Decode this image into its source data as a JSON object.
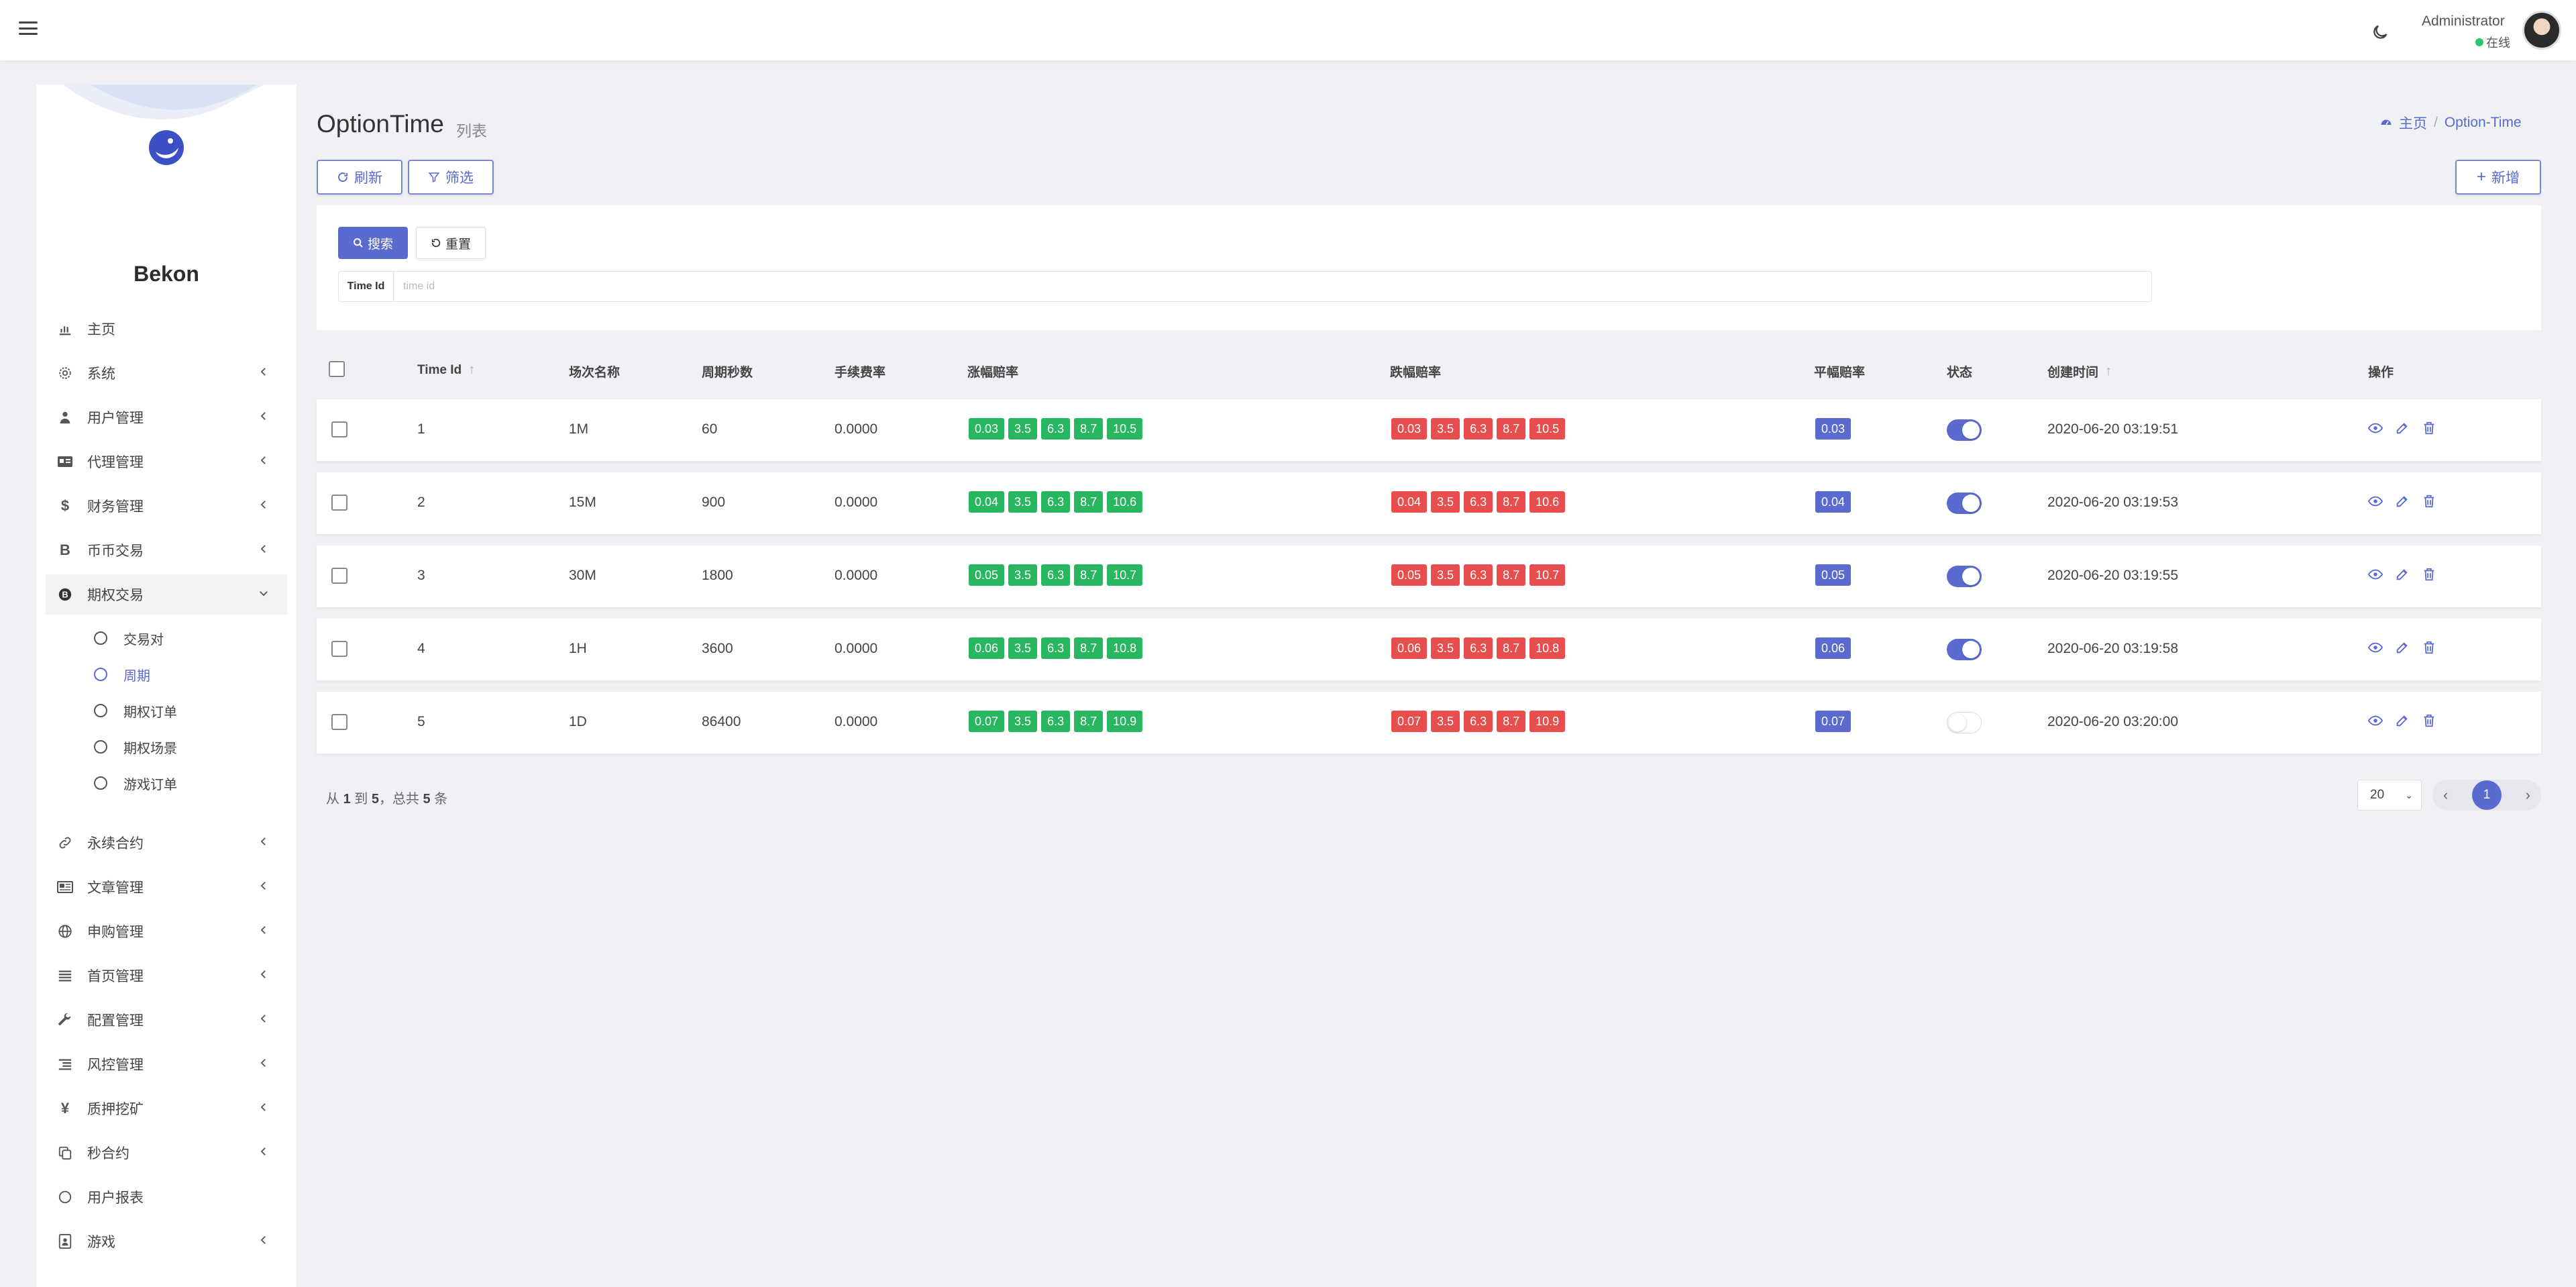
{
  "header": {
    "user_name": "Administrator",
    "user_status": "在线"
  },
  "sidebar": {
    "brand": "Bekon",
    "items": [
      {
        "label": "主页",
        "icon": "bar-chart-icon",
        "has_children": false
      },
      {
        "label": "系统",
        "icon": "gear-icon",
        "has_children": true
      },
      {
        "label": "用户管理",
        "icon": "user-icon",
        "has_children": true
      },
      {
        "label": "代理管理",
        "icon": "id-card-icon",
        "has_children": true
      },
      {
        "label": "财务管理",
        "icon": "dollar-icon",
        "has_children": true
      },
      {
        "label": "币币交易",
        "icon": "bitcoin-icon",
        "has_children": true
      },
      {
        "label": "期权交易",
        "icon": "bitcoin-circle-icon",
        "has_children": true,
        "expanded": true
      },
      {
        "label": "永续合约",
        "icon": "link-icon",
        "has_children": true
      },
      {
        "label": "文章管理",
        "icon": "newspaper-icon",
        "has_children": true
      },
      {
        "label": "申购管理",
        "icon": "globe-icon",
        "has_children": true
      },
      {
        "label": "首页管理",
        "icon": "list-icon",
        "has_children": true
      },
      {
        "label": "配置管理",
        "icon": "wrench-icon",
        "has_children": true
      },
      {
        "label": "风控管理",
        "icon": "list-indent-icon",
        "has_children": true
      },
      {
        "label": "质押挖矿",
        "icon": "yen-icon",
        "has_children": true
      },
      {
        "label": "秒合约",
        "icon": "copy-icon",
        "has_children": true
      },
      {
        "label": "用户报表",
        "icon": "circle-icon",
        "has_children": false
      },
      {
        "label": "游戏",
        "icon": "portrait-icon",
        "has_children": true
      }
    ],
    "subitems": [
      {
        "label": "交易对",
        "current": false
      },
      {
        "label": "周期",
        "current": true
      },
      {
        "label": "期权订单",
        "current": false
      },
      {
        "label": "期权场景",
        "current": false
      },
      {
        "label": "游戏订单",
        "current": false
      }
    ]
  },
  "page": {
    "title": "OptionTime",
    "subtitle": "列表",
    "breadcrumb_home": "主页",
    "breadcrumb_current": "Option-Time",
    "refresh_label": "刷新",
    "filter_label": "筛选",
    "add_label": "新增"
  },
  "filter": {
    "search_label": "搜索",
    "reset_label": "重置",
    "field_label": "Time Id",
    "field_placeholder": "time id",
    "field_value": ""
  },
  "table": {
    "columns": [
      "Time Id",
      "场次名称",
      "周期秒数",
      "手续费率",
      "涨幅赔率",
      "跌幅赔率",
      "平幅赔率",
      "状态",
      "创建时间",
      "操作"
    ],
    "rows": [
      {
        "id": "1",
        "name": "1M",
        "seconds": "60",
        "fee": "0.0000",
        "up": [
          "0.03",
          "3.5",
          "6.3",
          "8.7",
          "10.5"
        ],
        "down": [
          "0.03",
          "3.5",
          "6.3",
          "8.7",
          "10.5"
        ],
        "flat": "0.03",
        "status_on": true,
        "created": "2020-06-20 03:19:51"
      },
      {
        "id": "2",
        "name": "15M",
        "seconds": "900",
        "fee": "0.0000",
        "up": [
          "0.04",
          "3.5",
          "6.3",
          "8.7",
          "10.6"
        ],
        "down": [
          "0.04",
          "3.5",
          "6.3",
          "8.7",
          "10.6"
        ],
        "flat": "0.04",
        "status_on": true,
        "created": "2020-06-20 03:19:53"
      },
      {
        "id": "3",
        "name": "30M",
        "seconds": "1800",
        "fee": "0.0000",
        "up": [
          "0.05",
          "3.5",
          "6.3",
          "8.7",
          "10.7"
        ],
        "down": [
          "0.05",
          "3.5",
          "6.3",
          "8.7",
          "10.7"
        ],
        "flat": "0.05",
        "status_on": true,
        "created": "2020-06-20 03:19:55"
      },
      {
        "id": "4",
        "name": "1H",
        "seconds": "3600",
        "fee": "0.0000",
        "up": [
          "0.06",
          "3.5",
          "6.3",
          "8.7",
          "10.8"
        ],
        "down": [
          "0.06",
          "3.5",
          "6.3",
          "8.7",
          "10.8"
        ],
        "flat": "0.06",
        "status_on": true,
        "created": "2020-06-20 03:19:58"
      },
      {
        "id": "5",
        "name": "1D",
        "seconds": "86400",
        "fee": "0.0000",
        "up": [
          "0.07",
          "3.5",
          "6.3",
          "8.7",
          "10.9"
        ],
        "down": [
          "0.07",
          "3.5",
          "6.3",
          "8.7",
          "10.9"
        ],
        "flat": "0.07",
        "status_on": false,
        "created": "2020-06-20 03:20:00"
      }
    ]
  },
  "pagination": {
    "summary_prefix": "从",
    "from": "1",
    "summary_to": "到",
    "to": "5",
    "summary_total": "，总共",
    "total": "5",
    "summary_suffix": "条",
    "page_size": "20",
    "current_page": "1"
  },
  "colors": {
    "accent": "#5a6acf",
    "up_badge": "#28b661",
    "down_badge": "#e84e4e"
  }
}
